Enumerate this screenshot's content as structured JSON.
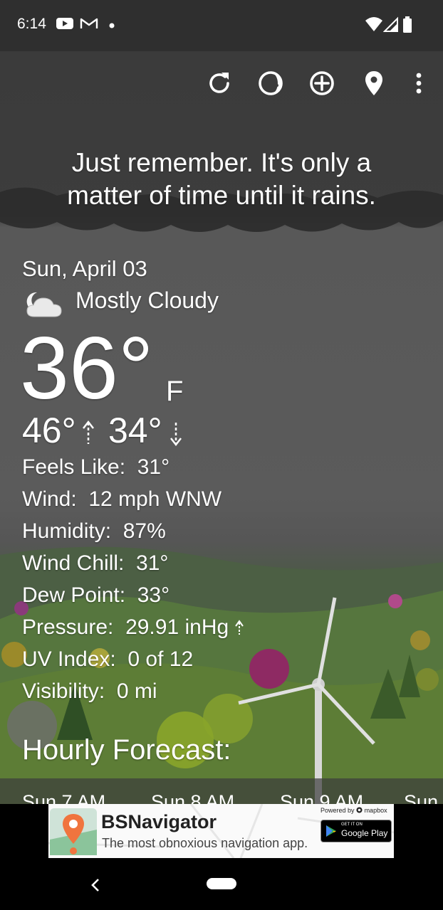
{
  "status": {
    "time": "6:14",
    "icons": [
      "youtube-icon",
      "gmail-icon",
      "dot-icon",
      "wifi-icon",
      "signal-icon",
      "battery-icon"
    ]
  },
  "toolbar": {
    "icons": [
      "refresh-icon",
      "theme-icon",
      "add-location-icon",
      "location-pin-icon",
      "more-vert-icon"
    ]
  },
  "quote": {
    "line1": "Just remember. It's only a",
    "line2": "matter of time until it rains."
  },
  "current": {
    "date": "Sun, April 03",
    "condition": "Mostly Cloudy",
    "condition_icon": "partly-cloudy-night-icon",
    "temp": "36°",
    "unit": "F",
    "high": "46°",
    "low": "34°"
  },
  "details": [
    {
      "label": "Feels Like:",
      "value": "31°"
    },
    {
      "label": "Wind:",
      "value": "12 mph WNW"
    },
    {
      "label": "Humidity:",
      "value": "87%"
    },
    {
      "label": "Wind Chill:",
      "value": "31°"
    },
    {
      "label": "Dew Point:",
      "value": "33°"
    },
    {
      "label": "Pressure:",
      "value": "29.91 inHg"
    },
    {
      "label": "UV Index:",
      "value": "0 of 12"
    },
    {
      "label": "Visibility:",
      "value": "0 mi"
    }
  ],
  "hourly": {
    "title": "Hourly Forecast:",
    "hours": [
      "Sun 7 AM",
      "Sun 8 AM",
      "Sun 9 AM",
      "Sun"
    ]
  },
  "ad": {
    "title": "BSNavigator",
    "subtitle": "The most obnoxious navigation app.",
    "powered": "Powered by",
    "brand": "mapbox",
    "store_small": "GET IT ON",
    "store_big": "Google Play"
  },
  "colors": {
    "statusbar": "#2f2f2f",
    "sky": "#3d3d3d",
    "text": "#ffffff",
    "hill": "#4f6a3a",
    "ad_accent": "#f0743e"
  }
}
